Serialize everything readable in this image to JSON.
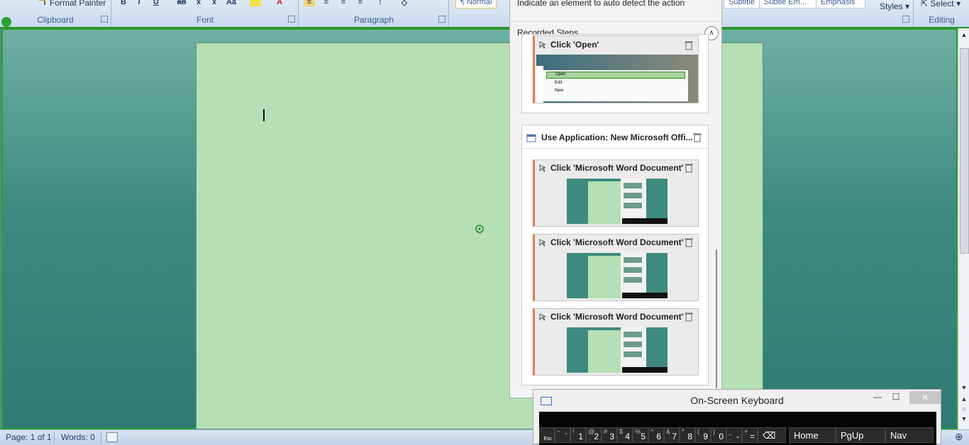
{
  "ribbon": {
    "clipboard": {
      "label": "Clipboard",
      "format_painter": "Format Painter"
    },
    "font": {
      "label": "Font"
    },
    "paragraph": {
      "label": "Paragraph"
    },
    "styles": {
      "normal": "¶ Normal",
      "subtitle": "Subtitle",
      "subtle_emphasis": "Subtle Em...",
      "emphasis": "Emphasis",
      "change_styles": "Styles"
    },
    "editing": {
      "label": "Editing",
      "select": "Select"
    }
  },
  "status": {
    "page": "Page: 1 of 1",
    "words": "Words: 0"
  },
  "panel": {
    "hint": "Indicate an element to auto detect the action",
    "recorded_steps": "Recorded Steps",
    "prev_step": "Click 'Open'",
    "thumb_menu": [
      "Open",
      "Edit",
      "New"
    ],
    "app_card": "Use Application: New Microsoft Offi...",
    "steps": [
      {
        "title": "Click 'Microsoft Word Document'"
      },
      {
        "title": "Click 'Microsoft Word Document'"
      },
      {
        "title": "Click 'Microsoft Word Document'"
      }
    ]
  },
  "osk": {
    "title": "On-Screen Keyboard",
    "keys": [
      {
        "top": "",
        "label": "Esc"
      },
      {
        "top": "~",
        "label": "`"
      },
      {
        "top": "!",
        "label": "1"
      },
      {
        "top": "@",
        "label": "2"
      },
      {
        "top": "#",
        "label": "3"
      },
      {
        "top": "$",
        "label": "4"
      },
      {
        "top": "%",
        "label": "5"
      },
      {
        "top": "^",
        "label": "6"
      },
      {
        "top": "&",
        "label": "7"
      },
      {
        "top": "*",
        "label": "8"
      },
      {
        "top": "(",
        "label": "9"
      },
      {
        "top": ")",
        "label": "0"
      },
      {
        "top": "_",
        "label": "-"
      },
      {
        "top": "+",
        "label": "="
      }
    ],
    "nav_keys": [
      "Home",
      "PgUp",
      "Nav"
    ]
  },
  "colors": {
    "accent_green": "#27a12c",
    "page": "#b5dfb4",
    "step_accent": "#e97a4a"
  }
}
